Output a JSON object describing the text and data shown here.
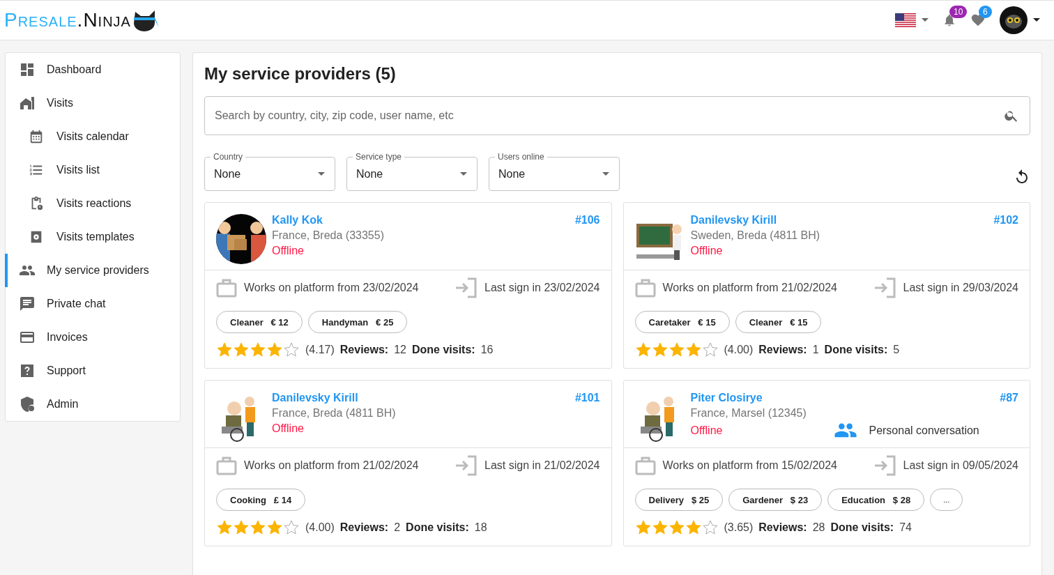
{
  "header": {
    "logo": {
      "part1": "Presale",
      "dot": ".",
      "part2": "Ninja"
    },
    "notifications": "10",
    "favorites": "6"
  },
  "sidebar": {
    "items": [
      {
        "label": "Dashboard",
        "selected": false
      },
      {
        "label": "Visits",
        "selected": false,
        "children": [
          {
            "label": "Visits calendar",
            "selected": false
          },
          {
            "label": "Visits list",
            "selected": false
          },
          {
            "label": "Visits reactions",
            "selected": false
          },
          {
            "label": "Visits templates",
            "selected": false
          }
        ]
      },
      {
        "label": "My service providers",
        "selected": true
      },
      {
        "label": "Private chat",
        "selected": false
      },
      {
        "label": "Invoices",
        "selected": false
      },
      {
        "label": "Support",
        "selected": false
      },
      {
        "label": "Admin",
        "selected": false
      }
    ]
  },
  "page": {
    "title": "My service providers (5)",
    "search": {
      "placeholder": "Search by country, city, zip code, user name, etc"
    },
    "filters": [
      {
        "label": "Country",
        "value": "None"
      },
      {
        "label": "Service type",
        "value": "None"
      },
      {
        "label": "Users online",
        "value": "None"
      }
    ]
  },
  "providers": [
    {
      "name": "Kally Kok",
      "number": "#106",
      "location": "France, Breda (33355)",
      "status": "Offline",
      "works": "Works on platform from 23/02/2024",
      "last_sign": "Last sign in 23/02/2024",
      "tags": [
        {
          "label": "Cleaner",
          "price": "€ 12"
        },
        {
          "label": "Handyman",
          "price": "€ 25"
        }
      ],
      "stars": 4,
      "rating": "(4.17)",
      "reviews_label": "Reviews:",
      "reviews": "12",
      "visits_label": "Done visits:",
      "visits": "16"
    },
    {
      "name": "Danilevsky Kirill",
      "number": "#102",
      "location": "Sweden, Breda (4811 BH)",
      "status": "Offline",
      "works": "Works on platform from 21/02/2024",
      "last_sign": "Last sign in 29/03/2024",
      "tags": [
        {
          "label": "Caretaker",
          "price": "€ 15"
        },
        {
          "label": "Cleaner",
          "price": "€ 15"
        }
      ],
      "stars": 4,
      "rating": "(4.00)",
      "reviews_label": "Reviews:",
      "reviews": "1",
      "visits_label": "Done visits:",
      "visits": "5"
    },
    {
      "name": "Danilevsky Kirill",
      "number": "#101",
      "location": "France, Breda (4811 BH)",
      "status": "Offline",
      "works": "Works on platform from 21/02/2024",
      "last_sign": "Last sign in 21/02/2024",
      "tags": [
        {
          "label": "Cooking",
          "price": "£ 14"
        }
      ],
      "stars": 4,
      "rating": "(4.00)",
      "reviews_label": "Reviews:",
      "reviews": "2",
      "visits_label": "Done visits:",
      "visits": "18"
    },
    {
      "name": "Piter Closirye",
      "number": "#87",
      "location": "France, Marsel (12345)",
      "status": "Offline",
      "conversation": "Personal conversation",
      "works": "Works on platform from 15/02/2024",
      "last_sign": "Last sign in 09/05/2024",
      "tags": [
        {
          "label": "Delivery",
          "price": "$ 25"
        },
        {
          "label": "Gardener",
          "price": "$ 23"
        },
        {
          "label": "Education",
          "price": "$ 28"
        }
      ],
      "more": "...",
      "stars": 4,
      "rating": "(3.65)",
      "reviews_label": "Reviews:",
      "reviews": "28",
      "visits_label": "Done visits:",
      "visits": "74"
    }
  ]
}
